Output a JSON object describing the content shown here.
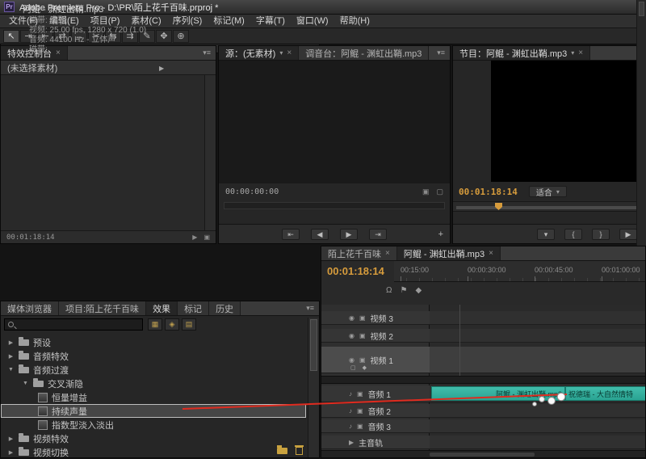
{
  "window": {
    "app_badge": "Pr",
    "title": "Adobe Premiere Pro - D:\\PR\\陌上花千百味.prproj *"
  },
  "menu": {
    "items": [
      "文件(F)",
      "编辑(E)",
      "项目(P)",
      "素材(C)",
      "序列(S)",
      "标记(M)",
      "字幕(T)",
      "窗口(W)",
      "帮助(H)"
    ]
  },
  "toolbar": {
    "tools": [
      {
        "name": "selection",
        "glyph": "↖"
      },
      {
        "name": "track-select",
        "glyph": "⇥"
      },
      {
        "name": "ripple-edit",
        "glyph": "⇤"
      },
      {
        "name": "rolling-edit",
        "glyph": "⇄"
      },
      {
        "name": "rate-stretch",
        "glyph": "↔"
      },
      {
        "name": "razor",
        "glyph": "✂"
      },
      {
        "name": "slip",
        "glyph": "⇆"
      },
      {
        "name": "slide",
        "glyph": "⇉"
      },
      {
        "name": "pen",
        "glyph": "✎"
      },
      {
        "name": "hand",
        "glyph": "✥"
      },
      {
        "name": "zoom",
        "glyph": "⊕"
      }
    ]
  },
  "icons": {
    "close": "×",
    "panel_menu": "▾≡",
    "chevron_down": "▾",
    "tri_right": "▶",
    "tri_down": "▼",
    "to_start": "⇤",
    "to_end": "⇥",
    "step_back": "◀",
    "play": "▶",
    "plus": "+",
    "marker": "▾",
    "go_in": "{",
    "go_out": "}",
    "eye": "◉",
    "speaker": "♪",
    "thumb": "▣",
    "square": "▢",
    "magnet": "Ω",
    "flag": "⚑",
    "diamond": "◆"
  },
  "panels": {
    "effect_controls": {
      "tab": "特效控制台",
      "empty_text": "(未选择素材)",
      "timecode": "00:01:18:14"
    },
    "source": {
      "tab_source": "源：(无素材)",
      "tab_mixer": "调音台：阿鲲 - 渊虹出鞘.mp3",
      "timecode": "00:00:00:00"
    },
    "program": {
      "tab": "节目：阿鲲 - 渊虹出鞘.mp3",
      "timecode": "00:01:18:14",
      "fit": "适合"
    },
    "info": {
      "clip_name": "阿鲲 - 渊虹出鞘.mp3",
      "rows": [
        "磁带: 序列",
        "视频: 25.00 fps, 1280 x 720 (1.0)",
        "音频: 44100 Hz - 立体声",
        "磁带:"
      ]
    },
    "effects": {
      "tabs": [
        "媒体浏览器",
        "项目:陌上花千百味",
        "效果",
        "标记",
        "历史"
      ],
      "tree": [
        {
          "label": "预设"
        },
        {
          "label": "音频特效"
        },
        {
          "label": "音频过渡"
        },
        {
          "label": "交叉渐隐"
        },
        {
          "label": "恒量增益"
        },
        {
          "label": "持续声量"
        },
        {
          "label": "指数型淡入淡出"
        },
        {
          "label": "视频特效"
        },
        {
          "label": "视频切换"
        }
      ]
    },
    "timeline": {
      "tabs": [
        "陌上花千百味",
        "阿鲲 - 渊虹出鞘.mp3"
      ],
      "timecode": "00:01:18:14",
      "ruler_labels": [
        "00:15:00",
        "00:00:30:00",
        "00:00:45:00",
        "00:01:00:00"
      ],
      "video_tracks": [
        "视频 3",
        "视频 2",
        "视频 1"
      ],
      "audio_tracks": [
        "音频 1",
        "音频 2",
        "音频 3"
      ],
      "master_track": "主音轨",
      "clips": [
        {
          "label": "阿鲲 - 渊虹出鞘.mp3"
        },
        {
          "label": "祝德瑞 - 大自然情特"
        }
      ]
    }
  },
  "colors": {
    "timecode_orange": "#d79c3c",
    "clip_teal": "#2fae9e",
    "drag_line_red": "#e02b1f",
    "selection_gray": "#464646"
  }
}
